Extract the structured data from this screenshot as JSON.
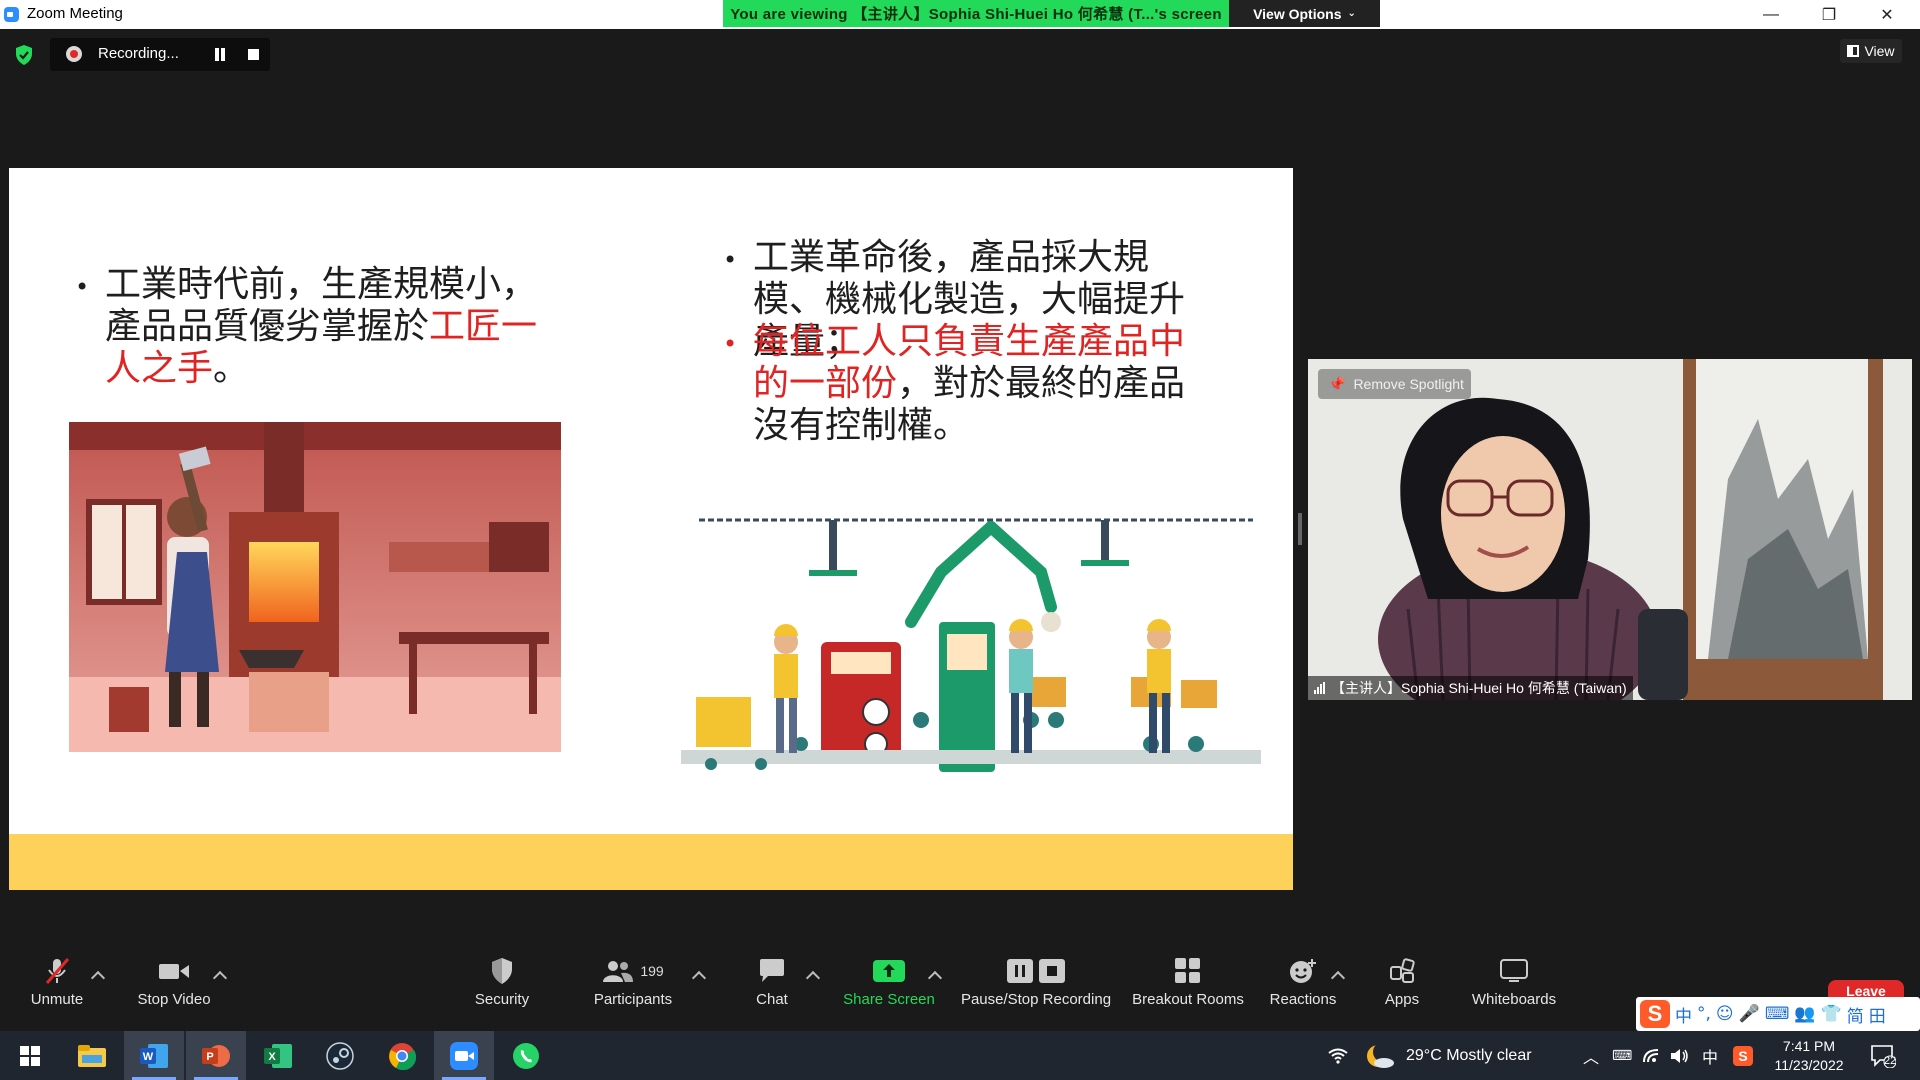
{
  "window": {
    "title": "Zoom Meeting",
    "viewing_banner": "You are viewing 【主讲人】Sophia Shi-Huei Ho 何希慧 (T...'s screen",
    "view_options": "View Options",
    "controls": [
      "minimize-icon",
      "restore-icon",
      "close-icon"
    ]
  },
  "recording": {
    "label": "Recording...",
    "state": "recording"
  },
  "view_button": {
    "label": "View"
  },
  "slide": {
    "bullet1": {
      "text": "工業時代前，生產規模小，產品品質優劣掌握於",
      "highlight": "工匠一人之手",
      "tail": "。"
    },
    "bullet2": {
      "text": "工業革命後，產品採大規模、機械化製造，大幅提升產量；"
    },
    "bullet3": {
      "highlight": "每位工人只負責生產產品中的一部份",
      "text": "，對於最終的產品沒有控制權。"
    },
    "colors": {
      "text": "#1e1e1e",
      "highlight": "#e02424",
      "band": "#fdd15a"
    }
  },
  "video": {
    "spotlight_label": "Remove Spotlight",
    "participant_name": "【主讲人】Sophia Shi-Huei Ho 何希慧 (Taiwan)"
  },
  "toolbar": {
    "unmute": "Unmute",
    "stop_video": "Stop Video",
    "security": "Security",
    "participants": "Participants",
    "participants_count": "199",
    "chat": "Chat",
    "share_screen": "Share Screen",
    "pause_stop_recording": "Pause/Stop Recording",
    "breakout_rooms": "Breakout Rooms",
    "reactions": "Reactions",
    "apps": "Apps",
    "whiteboards": "Whiteboards",
    "leave": "Leave",
    "accent": "#23d959"
  },
  "ime": {
    "logo": "S",
    "items": [
      "中",
      "°,",
      "☺",
      "🎤",
      "⌨",
      "👥",
      "👕",
      "简",
      "田"
    ]
  },
  "taskbar": {
    "apps": [
      "windows-start",
      "file-explorer",
      "word",
      "powerpoint",
      "excel",
      "steam",
      "chrome",
      "zoom",
      "whatsapp"
    ],
    "weather": "29°C  Mostly clear",
    "time": "7:41 PM",
    "date": "11/23/2022",
    "lang": "中",
    "notifications": "22"
  }
}
